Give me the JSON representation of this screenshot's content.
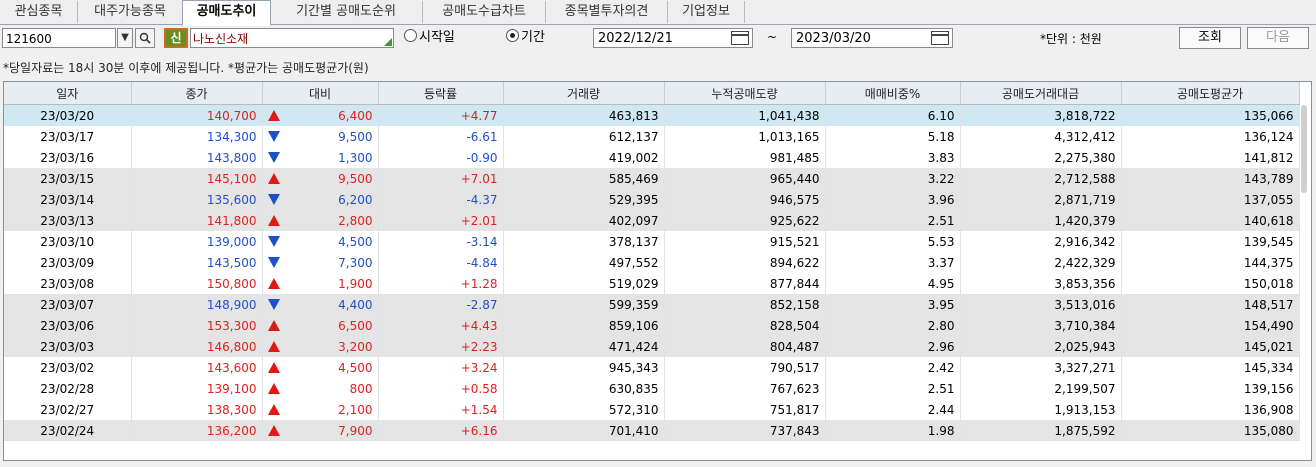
{
  "tabs": [
    "관심종목",
    "대주가능종목",
    "공매도추이",
    "기간별 공매도순위",
    "공매도수급차트",
    "종목별투자의견",
    "기업정보"
  ],
  "active_tab": 2,
  "toolbar": {
    "code": "121600",
    "new_badge": "신",
    "stock_name": "나노신소재",
    "radio_start": "시작일",
    "radio_period": "기간",
    "date_from": "2022/12/21",
    "date_sep": "~",
    "date_to": "2023/03/20",
    "unit": "*단위 : 천원",
    "search_button": "조회",
    "next_button": "다음"
  },
  "notice": "*당일자료는 18시 30분 이후에 제공됩니다. *평균가는 공매도평균가(원)",
  "columns": [
    "일자",
    "종가",
    "대비",
    "등락률",
    "거래량",
    "누적공매도량",
    "매매비중%",
    "공매도거래대금",
    "공매도평균가"
  ],
  "rows": [
    {
      "date": "23/03/20",
      "close": "140,700",
      "dir": "up",
      "change": "6,400",
      "rate": "+4.77",
      "volume": "463,813",
      "cum_short": "1,041,438",
      "ratio": "6.10",
      "amount": "3,818,722",
      "avg": "135,066"
    },
    {
      "date": "23/03/17",
      "close": "134,300",
      "dir": "dn",
      "change": "9,500",
      "rate": "-6.61",
      "volume": "612,137",
      "cum_short": "1,013,165",
      "ratio": "5.18",
      "amount": "4,312,412",
      "avg": "136,124"
    },
    {
      "date": "23/03/16",
      "close": "143,800",
      "dir": "dn",
      "change": "1,300",
      "rate": "-0.90",
      "volume": "419,002",
      "cum_short": "981,485",
      "ratio": "3.83",
      "amount": "2,275,380",
      "avg": "141,812"
    },
    {
      "date": "23/03/15",
      "close": "145,100",
      "dir": "up",
      "change": "9,500",
      "rate": "+7.01",
      "volume": "585,469",
      "cum_short": "965,440",
      "ratio": "3.22",
      "amount": "2,712,588",
      "avg": "143,789"
    },
    {
      "date": "23/03/14",
      "close": "135,600",
      "dir": "dn",
      "change": "6,200",
      "rate": "-4.37",
      "volume": "529,395",
      "cum_short": "946,575",
      "ratio": "3.96",
      "amount": "2,871,719",
      "avg": "137,055"
    },
    {
      "date": "23/03/13",
      "close": "141,800",
      "dir": "up",
      "change": "2,800",
      "rate": "+2.01",
      "volume": "402,097",
      "cum_short": "925,622",
      "ratio": "2.51",
      "amount": "1,420,379",
      "avg": "140,618"
    },
    {
      "date": "23/03/10",
      "close": "139,000",
      "dir": "dn",
      "change": "4,500",
      "rate": "-3.14",
      "volume": "378,137",
      "cum_short": "915,521",
      "ratio": "5.53",
      "amount": "2,916,342",
      "avg": "139,545"
    },
    {
      "date": "23/03/09",
      "close": "143,500",
      "dir": "dn",
      "change": "7,300",
      "rate": "-4.84",
      "volume": "497,552",
      "cum_short": "894,622",
      "ratio": "3.37",
      "amount": "2,422,329",
      "avg": "144,375"
    },
    {
      "date": "23/03/08",
      "close": "150,800",
      "dir": "up",
      "change": "1,900",
      "rate": "+1.28",
      "volume": "519,029",
      "cum_short": "877,844",
      "ratio": "4.95",
      "amount": "3,853,356",
      "avg": "150,018"
    },
    {
      "date": "23/03/07",
      "close": "148,900",
      "dir": "dn",
      "change": "4,400",
      "rate": "-2.87",
      "volume": "599,359",
      "cum_short": "852,158",
      "ratio": "3.95",
      "amount": "3,513,016",
      "avg": "148,517"
    },
    {
      "date": "23/03/06",
      "close": "153,300",
      "dir": "up",
      "change": "6,500",
      "rate": "+4.43",
      "volume": "859,106",
      "cum_short": "828,504",
      "ratio": "2.80",
      "amount": "3,710,384",
      "avg": "154,490"
    },
    {
      "date": "23/03/03",
      "close": "146,800",
      "dir": "up",
      "change": "3,200",
      "rate": "+2.23",
      "volume": "471,424",
      "cum_short": "804,487",
      "ratio": "2.96",
      "amount": "2,025,943",
      "avg": "145,021"
    },
    {
      "date": "23/03/02",
      "close": "143,600",
      "dir": "up",
      "change": "4,500",
      "rate": "+3.24",
      "volume": "945,343",
      "cum_short": "790,517",
      "ratio": "2.42",
      "amount": "3,327,271",
      "avg": "145,334"
    },
    {
      "date": "23/02/28",
      "close": "139,100",
      "dir": "up",
      "change": "800",
      "rate": "+0.58",
      "volume": "630,835",
      "cum_short": "767,623",
      "ratio": "2.51",
      "amount": "2,199,507",
      "avg": "139,156"
    },
    {
      "date": "23/02/27",
      "close": "138,300",
      "dir": "up",
      "change": "2,100",
      "rate": "+1.54",
      "volume": "572,310",
      "cum_short": "751,817",
      "ratio": "2.44",
      "amount": "1,913,153",
      "avg": "136,908"
    },
    {
      "date": "23/02/24",
      "close": "136,200",
      "dir": "up",
      "change": "7,900",
      "rate": "+6.16",
      "volume": "701,410",
      "cum_short": "737,843",
      "ratio": "1.98",
      "amount": "1,875,592",
      "avg": "135,080"
    }
  ],
  "row_shading": [
    "sel",
    "w",
    "w",
    "g",
    "g",
    "g",
    "w",
    "w",
    "w",
    "g",
    "g",
    "g",
    "w",
    "w",
    "w",
    "g"
  ],
  "colors": {
    "up": "#e02020",
    "down": "#1f4fc8",
    "selected_row": "#cfe8f3",
    "alt_row": "#e4e4e4"
  }
}
